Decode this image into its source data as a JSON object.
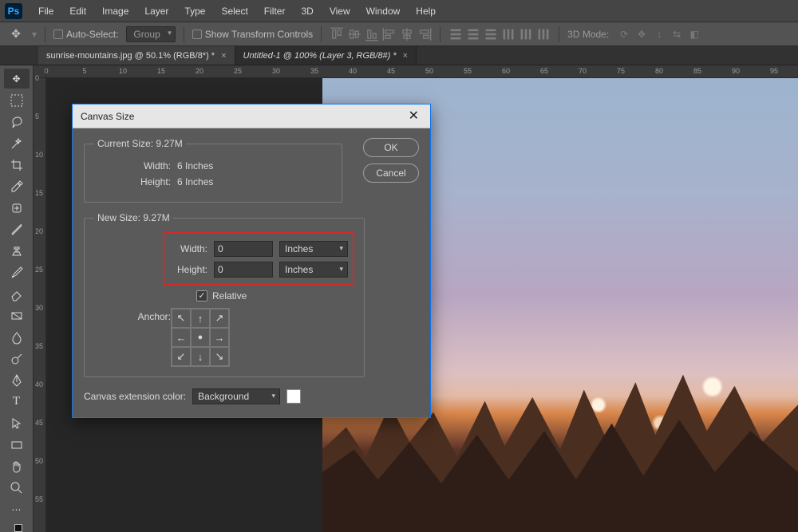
{
  "menubar": {
    "items": [
      "File",
      "Edit",
      "Image",
      "Layer",
      "Type",
      "Select",
      "Filter",
      "3D",
      "View",
      "Window",
      "Help"
    ]
  },
  "optionsbar": {
    "auto_select_label": "Auto-Select:",
    "auto_select_mode": "Group",
    "show_transform_label": "Show Transform Controls",
    "mode_3d_label": "3D Mode:"
  },
  "doctabs": {
    "tabs": [
      {
        "label": "sunrise-mountains.jpg @ 50.1% (RGB/8*) *",
        "active": true
      },
      {
        "label": "Untitled-1 @ 100% (Layer 3, RGB/8#) *",
        "active": false
      }
    ]
  },
  "ruler_h": [
    "0",
    "5",
    "10",
    "15",
    "20",
    "25",
    "30",
    "35",
    "40",
    "45",
    "50",
    "55",
    "60",
    "65",
    "70",
    "75",
    "80",
    "85",
    "90",
    "95"
  ],
  "ruler_v": [
    "0",
    "5",
    "10",
    "15",
    "20",
    "25",
    "30",
    "35",
    "40",
    "45",
    "50",
    "55"
  ],
  "dialog": {
    "title": "Canvas Size",
    "ok_label": "OK",
    "cancel_label": "Cancel",
    "current_size_legend": "Current Size: 9.27M",
    "current": {
      "width_label": "Width:",
      "width_value": "6 Inches",
      "height_label": "Height:",
      "height_value": "6 Inches"
    },
    "new_size_legend": "New Size: 9.27M",
    "new": {
      "width_label": "Width:",
      "width_value": "0",
      "width_unit": "Inches",
      "height_label": "Height:",
      "height_value": "0",
      "height_unit": "Inches"
    },
    "relative_label": "Relative",
    "relative_checked": true,
    "anchor_label": "Anchor:",
    "ext_color_label": "Canvas extension color:",
    "ext_color_value": "Background"
  }
}
